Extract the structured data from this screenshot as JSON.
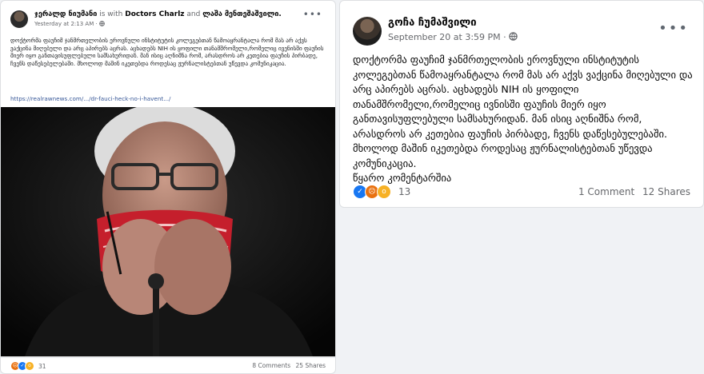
{
  "left_post": {
    "author": "ჯერალდ ნიუმანი",
    "with_text": "is with",
    "tagged_1": "Doctors Charlz",
    "and_text": "and",
    "tagged_2": "ლაშა მენთეშაშვილი.",
    "timestamp": "Yesterday at 2:13 AM ·",
    "text": "დოქტორმა ფაუჩიმ ჯანმრთელობის ეროვნული ინსტიტუტის კოლეგებთან წამოაყრანტალა რომ მას არ აქვს ვაქცინა მიღებული და არც აპირებს აცრას. აცხადებს NIH ის ყოფილი თანამშრომელი,რომელიც ივენისში ფაუჩის მიერ იყო განთავისუფლებული სამსახურიდან. მან ისიც აღნიშნა რომ, არასდროს არ კეთებია ფაუჩის პირბადე, ჩვენს დაწესებულებაში. მხოლოდ მაშინ იკეთებდა როდესაც ჟურნალისტებთან უწევდა კომუნიკაცია.",
    "link": "https://realrawnews.com/.../dr-fauci-heck-no-i-havent.../",
    "reaction_count": "31",
    "comments": "8 Comments",
    "shares": "25 Shares"
  },
  "right_post": {
    "author": "გოჩა ჩუმაშვილი",
    "timestamp": "September 20 at 3:59 PM ·",
    "text": "დოქტორმა ფაუჩიმ ჯანმრთელობის ეროვნული ინსტიტუტის კოლეგებთან წამოაყრანტალა რომ მას არ აქვს ვაქცინა მიღებული და არც აპირებს აცრას. აცხადებს NIH ის ყოფილი თანამშრომელი,რომელიც ივნისში ფაუჩის მიერ იყო განთავისუფლებული სამსახურიდან. მან ისიც აღნიშნა რომ, არასდროს არ კეთებია ფაუჩის პირბადე, ჩვენს დაწესებულებაში. მხოლოდ მაშინ იკეთებდა როდესაც ჟურნალისტებთან უწევდა კომუნიკაცია.",
    "source_note": "წყარო კომენტარშია",
    "reaction_count": "13",
    "comments": "1 Comment",
    "shares": "12 Shares"
  },
  "icons": {
    "like": "like-icon",
    "angry": "angry-icon",
    "wow": "wow-icon",
    "globe": "globe-icon",
    "more": "more-options-icon"
  },
  "colors": {
    "link": "#385898",
    "like": "#1877f2",
    "angry": "#e9710f",
    "wow": "#f7b125"
  }
}
